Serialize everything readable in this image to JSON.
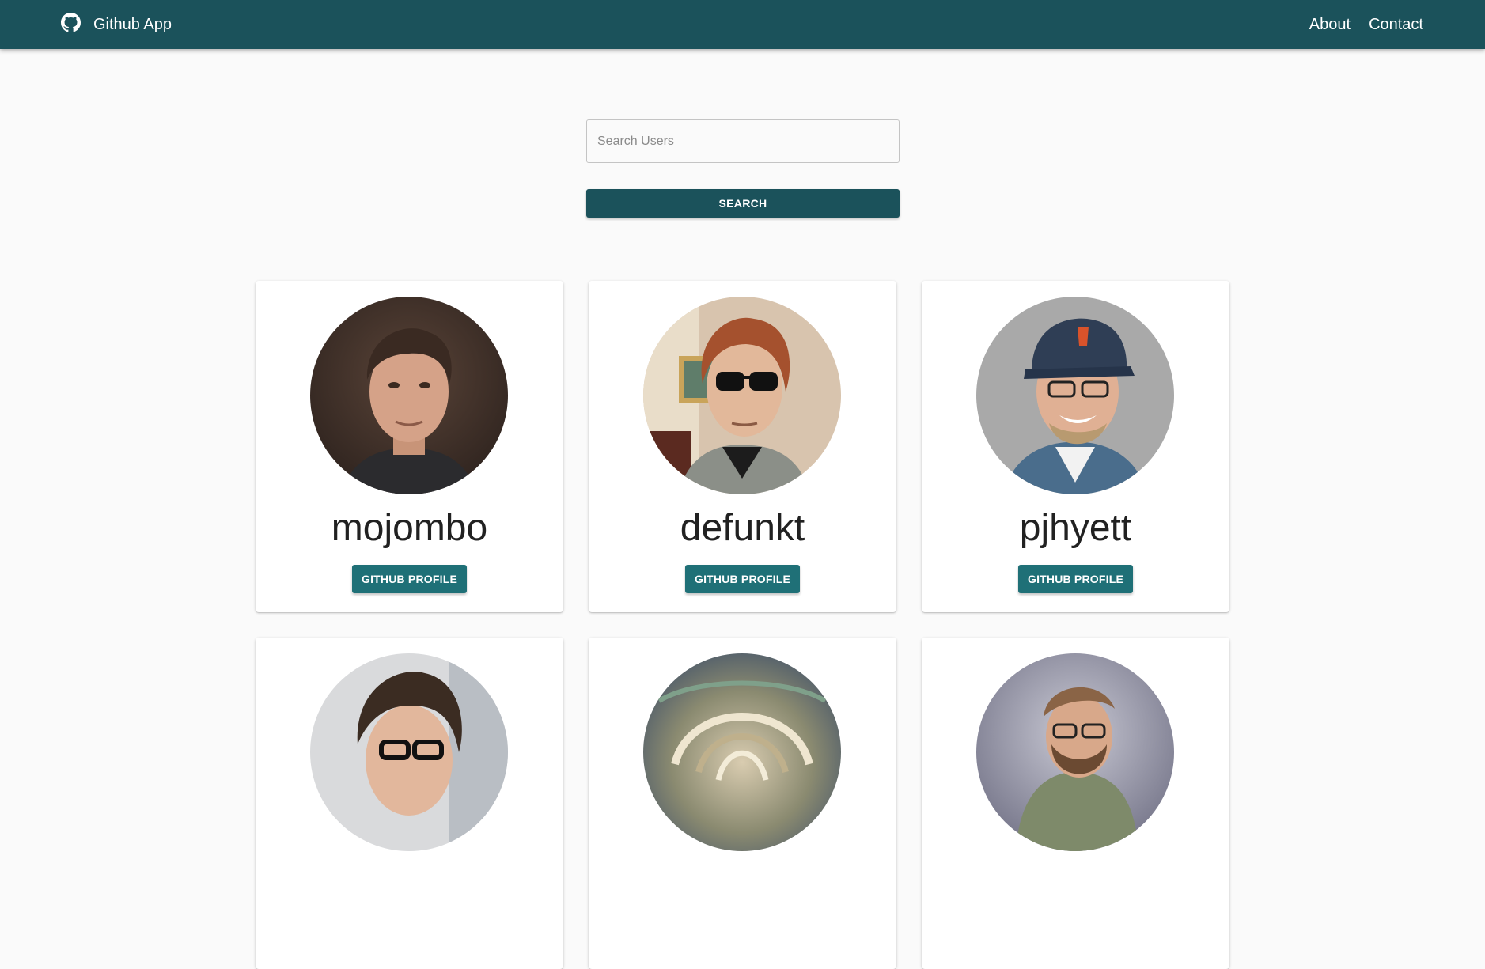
{
  "navbar": {
    "brand_icon": "github-icon",
    "brand_label": "Github App",
    "links": [
      "About",
      "Contact"
    ],
    "color": "#1b525b"
  },
  "search": {
    "placeholder": "Search Users",
    "value": "",
    "button_label": "SEARCH"
  },
  "users": [
    {
      "login": "mojombo",
      "button_label": "GITHUB PROFILE"
    },
    {
      "login": "defunkt",
      "button_label": "GITHUB PROFILE"
    },
    {
      "login": "pjhyett",
      "button_label": "GITHUB PROFILE"
    },
    {
      "login": "",
      "button_label": ""
    },
    {
      "login": "",
      "button_label": ""
    },
    {
      "login": "",
      "button_label": ""
    }
  ],
  "colors": {
    "navbar": "#1b525b",
    "search_button": "#1b525b",
    "profile_button": "#1f7077",
    "background": "#fafafa"
  }
}
